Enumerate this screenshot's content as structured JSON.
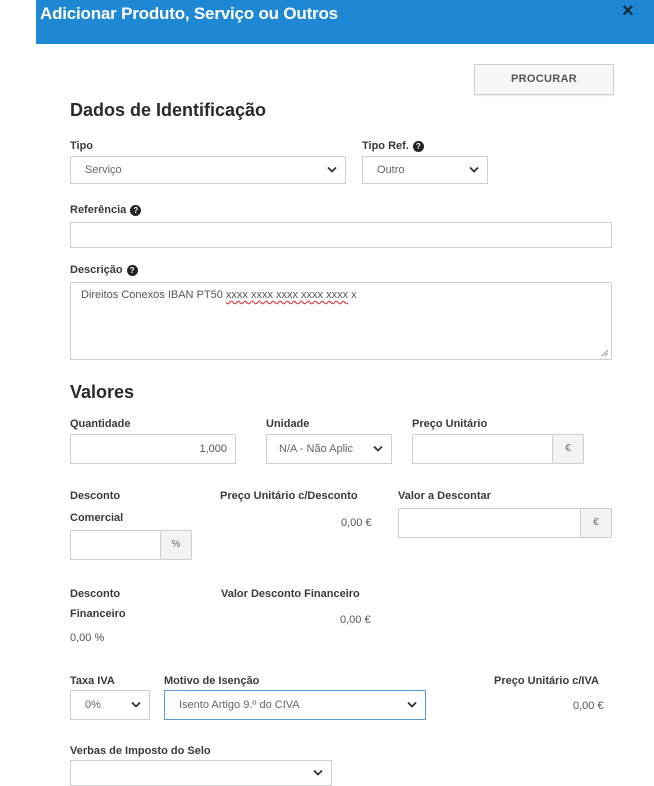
{
  "modal": {
    "title": "Adicionar Produto, Serviço ou Outros",
    "close": "×"
  },
  "toolbar": {
    "search_label": "PROCURAR"
  },
  "identification": {
    "heading": "Dados de Identificação",
    "tipo": {
      "label": "Tipo",
      "value": "Serviço"
    },
    "tipo_ref": {
      "label": "Tipo Ref.",
      "value": "Outro"
    },
    "referencia": {
      "label": "Referência",
      "value": ""
    },
    "descricao": {
      "label": "Descrição",
      "value_prefix": "Direitos Conexos IBAN PT50 ",
      "value_misspelled": "xxxx xxxx xxxx xxxx xxxx",
      "value_suffix": " x"
    }
  },
  "values": {
    "heading": "Valores",
    "quantidade": {
      "label": "Quantidade",
      "value": "1,000"
    },
    "unidade": {
      "label": "Unidade",
      "value": "N/A - Não Aplic"
    },
    "preco_unitario": {
      "label": "Preço Unitário",
      "value": "",
      "currency": "€"
    },
    "desconto_comercial": {
      "label_line1": "Desconto",
      "label_line2": "Comercial",
      "value": "",
      "unit": "%"
    },
    "preco_unitario_desconto": {
      "label": "Preço Unitário c/Desconto",
      "value": "0,00 €"
    },
    "valor_descontar": {
      "label": "Valor a Descontar",
      "value": "",
      "currency": "€"
    },
    "desconto_financeiro": {
      "label_line1": "Desconto",
      "label_line2": "Financeiro",
      "value": "0,00 %"
    },
    "valor_desconto_financeiro": {
      "label": "Valor Desconto Financeiro",
      "value": "0,00 €"
    },
    "taxa_iva": {
      "label": "Taxa IVA",
      "value": "0%"
    },
    "motivo_isencao": {
      "label": "Motivo de Isenção",
      "value": "Isento Artigo 9.º do CIVA"
    },
    "preco_unitario_iva": {
      "label": "Preço Unitário c/IVA",
      "value": "0,00 €"
    },
    "verbas_selo": {
      "label": "Verbas de Imposto do Selo",
      "value": ""
    }
  }
}
